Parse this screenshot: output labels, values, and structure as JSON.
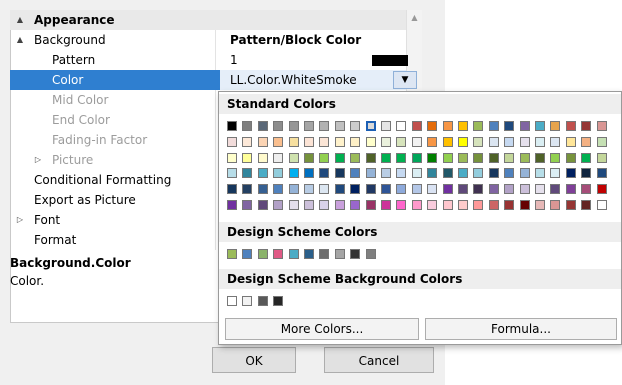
{
  "grid": {
    "rows": [
      {
        "label": "Appearance",
        "value": "",
        "kind": "cat",
        "expander": "▲"
      },
      {
        "label": "Background",
        "value": "Pattern/Block Color",
        "kind": "top",
        "expander": "▲",
        "bold_value": true
      },
      {
        "label": "Pattern",
        "value": "1",
        "kind": "sub",
        "expander": ""
      },
      {
        "label": "Color",
        "value": "LL.Color.WhiteSmoke",
        "kind": "sub-sel",
        "expander": ""
      },
      {
        "label": "Mid Color",
        "value": "",
        "kind": "sub-dis",
        "expander": ""
      },
      {
        "label": "End Color",
        "value": "",
        "kind": "sub-dis",
        "expander": ""
      },
      {
        "label": "Fading-in Factor",
        "value": "",
        "kind": "sub-dis",
        "expander": ""
      },
      {
        "label": "Picture",
        "value": "",
        "kind": "sub-dis",
        "expander": "▷"
      },
      {
        "label": "Conditional Formatting",
        "value": "",
        "kind": "top",
        "expander": ""
      },
      {
        "label": "Export as Picture",
        "value": "",
        "kind": "top",
        "expander": ""
      },
      {
        "label": "Font",
        "value": "",
        "kind": "top",
        "expander": "▷"
      },
      {
        "label": "Format",
        "value": "",
        "kind": "top",
        "expander": ""
      }
    ],
    "help_title": "Background.Color",
    "help_text": "Color."
  },
  "buttons": {
    "ok": "OK",
    "cancel": "Cancel"
  },
  "popup": {
    "standard_title": "Standard Colors",
    "design_title": "Design Scheme Colors",
    "background_title": "Design Scheme Background Colors",
    "more_colors": "More Colors...",
    "formula": "Formula...",
    "standard_colors": [
      [
        "#000000",
        "#7f7f7f",
        "#5a6878",
        "#8d8d8d",
        "#969696",
        "#a5a5a5",
        "#b2b2b2",
        "#c0c0c0",
        "#cccccc",
        "#d9d9d9",
        "#e5e5e5",
        "#ffffff",
        "#c0504d",
        "#e46c0a",
        "#f79646",
        "#ffc000",
        "#9bbb59",
        "#4f81bd",
        "#1f497d",
        "#8064a2",
        "#4bacc6",
        "#e7a44c",
        "#c0504d",
        "#953735",
        "#d99694"
      ],
      [
        "#f2dcdb",
        "#fde9d9",
        "#fbd4b4",
        "#fabf8f",
        "#f7e0a0",
        "#fce4d6",
        "#fbe5d6",
        "#fff2cc",
        "#fef0c7",
        "#ffffcc",
        "#eaf1dd",
        "#d7e4bc",
        "#f2f2f2",
        "#f79646",
        "#ffc000",
        "#ffff00",
        "#d6e3bc",
        "#dbe5f1",
        "#c6d9f1",
        "#e5e0ec",
        "#daeef3",
        "#dce6f2",
        "#ffe699",
        "#f4b183",
        "#c5e0b4"
      ],
      [
        "#ffffcc",
        "#ffff99",
        "#fffacd",
        "#eeeeee",
        "#cfe2ae",
        "#76923c",
        "#92d050",
        "#00b050",
        "#9bbb59",
        "#4f6228",
        "#00b050",
        "#00b050",
        "#00a65a",
        "#008000",
        "#92d050",
        "#9bbb59",
        "#76923c",
        "#4f6228",
        "#c4d79b",
        "#9bbb59",
        "#4f6228",
        "#92d050",
        "#77933c",
        "#00b050",
        "#c4d79b"
      ],
      [
        "#b7dde8",
        "#31859c",
        "#4bacc6",
        "#92cddc",
        "#00b0f0",
        "#0070c0",
        "#1f497d",
        "#17375e",
        "#4f81bd",
        "#95b3d7",
        "#b9cde5",
        "#c6d9f1",
        "#dbeef3",
        "#31859b",
        "#215868",
        "#4bacc6",
        "#93cddd",
        "#17375e",
        "#4f81bd",
        "#95b3d7",
        "#b7dee8",
        "#dbeef4",
        "#002060",
        "#0f243e",
        "#1f497d"
      ],
      [
        "#16365c",
        "#244062",
        "#366092",
        "#4f81bd",
        "#95b3d7",
        "#b8cce4",
        "#dce6f1",
        "#1f497d",
        "#002060",
        "#203864",
        "#2f5597",
        "#8eaadb",
        "#b4c7e7",
        "#dae3f3",
        "#7030a0",
        "#5f497a",
        "#403151",
        "#8064a2",
        "#b2a2c7",
        "#ccc0da",
        "#e5e0ec",
        "#604a7b",
        "#7f3f98",
        "#a64d79",
        "#c00000"
      ],
      [
        "#7030a0",
        "#8064a2",
        "#60497a",
        "#b2a1c7",
        "#e4dfec",
        "#ccc0da",
        "#d9d2e9",
        "#c9a0dc",
        "#9966cc",
        "#993366",
        "#cc3399",
        "#ff66cc",
        "#ff99cc",
        "#f9ccdd",
        "#ffc7ce",
        "#ffcccc",
        "#ff9999",
        "#cc6666",
        "#993333",
        "#660000",
        "#e6b8b7",
        "#da9694",
        "#963634",
        "#632523",
        "#ffffff"
      ]
    ],
    "design_colors": [
      "#9bbb59",
      "#4f81bd",
      "#8bb36a",
      "#e05a86",
      "#4bacc6",
      "#2b5f8a",
      "#6d6d6d",
      "#a5a5a5",
      "#333333",
      "#7f7f7f"
    ],
    "background_colors": [
      "#ffffff",
      "#f2f2f2",
      "#595959",
      "#262626"
    ]
  }
}
